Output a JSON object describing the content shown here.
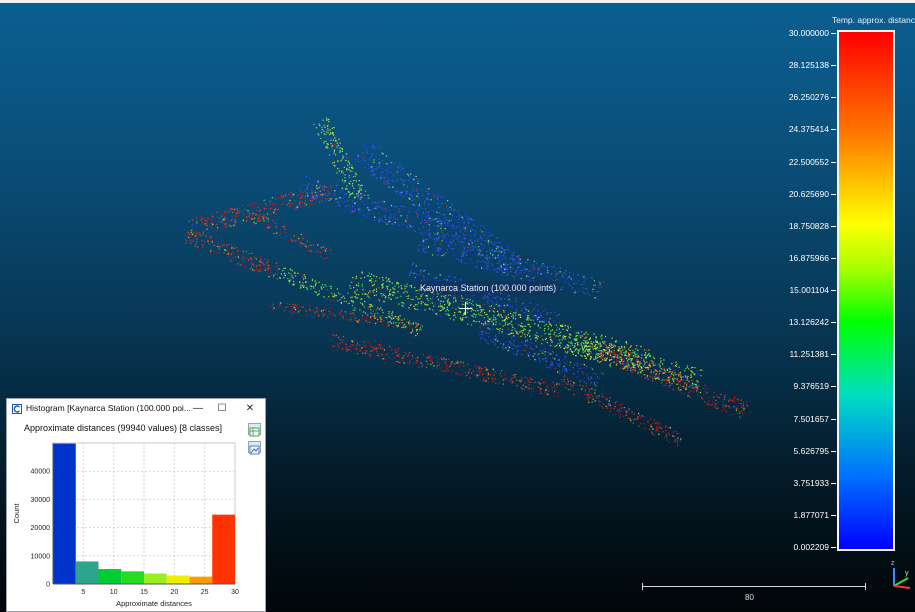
{
  "viewport": {
    "background_top": "#0b5f91",
    "background_bottom": "#010608",
    "entity_label": "Kaynarca Station (100.000 points)"
  },
  "scalebar": {
    "title": "Temp. approx. distanc",
    "ticks": [
      "30.000000",
      "28.125138",
      "26.250276",
      "24.375414",
      "22.500552",
      "20.625690",
      "18.750828",
      "16.875966",
      "15.001104",
      "13.126242",
      "11.251381",
      "9.376519",
      "7.501657",
      "5.626795",
      "3.751933",
      "1.877071",
      "0.002209"
    ],
    "colors": [
      "#ff0000",
      "#ffff00",
      "#00ff00",
      "#0000ff"
    ]
  },
  "scale_bar": {
    "value": "80"
  },
  "axis": {
    "z": "z",
    "y": "y"
  },
  "histogram_window": {
    "title": "Histogram [Kaynarca Station (100.000 poi...",
    "controls": {
      "minimize": "—",
      "maximize": "☐",
      "close": "✕"
    },
    "tools": [
      "export-csv-icon",
      "export-image-icon"
    ]
  },
  "chart_data": {
    "type": "bar",
    "title": "Approximate distances (99940 values) [8 classes]",
    "xlabel": "Approximate distances",
    "ylabel": "Count",
    "xlim": [
      0,
      30
    ],
    "ylim": [
      0,
      50000
    ],
    "xticks": [
      5,
      10,
      15,
      20,
      25,
      30
    ],
    "yticks": [
      0,
      10000,
      20000,
      30000,
      40000
    ],
    "grid": true,
    "bins": [
      {
        "from": 0,
        "to": 3.75,
        "value": 49800,
        "color": "#0033cc"
      },
      {
        "from": 3.75,
        "to": 7.5,
        "value": 8000,
        "color": "#2ea58a"
      },
      {
        "from": 7.5,
        "to": 11.25,
        "value": 5300,
        "color": "#00cc33"
      },
      {
        "from": 11.25,
        "to": 15,
        "value": 4500,
        "color": "#22dd22"
      },
      {
        "from": 15,
        "to": 18.75,
        "value": 3700,
        "color": "#99ee22"
      },
      {
        "from": 18.75,
        "to": 22.5,
        "value": 3000,
        "color": "#eeee00"
      },
      {
        "from": 22.5,
        "to": 26.25,
        "value": 2600,
        "color": "#ff9900"
      },
      {
        "from": 26.25,
        "to": 30,
        "value": 24600,
        "color": "#ff3300"
      }
    ]
  }
}
